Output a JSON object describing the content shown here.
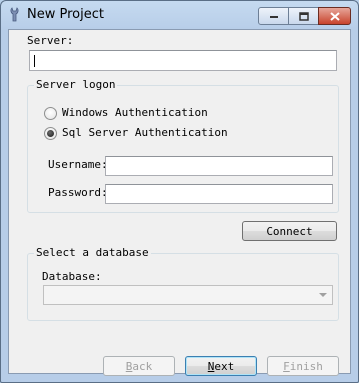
{
  "window": {
    "title": "New Project"
  },
  "server": {
    "label": "Server:",
    "value": ""
  },
  "logon": {
    "group_title": "Server logon",
    "options": [
      {
        "label": "Windows Authentication",
        "selected": false
      },
      {
        "label": "Sql Server Authentication",
        "selected": true
      }
    ],
    "username_label": "Username:",
    "username_value": "",
    "password_label": "Password:",
    "password_value": ""
  },
  "connect_button": "Connect",
  "database": {
    "group_title": "Select a database",
    "label": "Database:",
    "selected": "",
    "enabled": false
  },
  "buttons": {
    "back": {
      "accel": "B",
      "rest": "ack",
      "enabled": false
    },
    "next": {
      "accel": "N",
      "rest": "ext",
      "enabled": true
    },
    "finish": {
      "accel": "F",
      "rest": "inish",
      "enabled": false
    }
  },
  "icons": {
    "app": "tools-icon",
    "minimize": "minimize-icon",
    "maximize": "maximize-icon",
    "close": "close-icon",
    "dropdown": "chevron-down-icon"
  }
}
